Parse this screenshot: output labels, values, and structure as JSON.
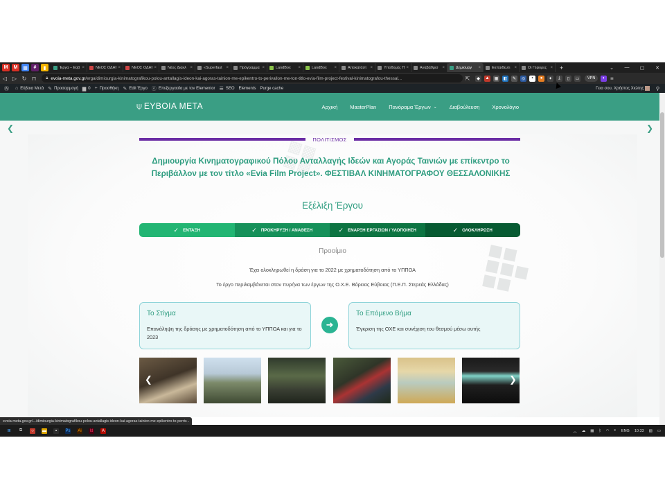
{
  "browser": {
    "pinned_tabs": [
      {
        "icon": "gmail-icon",
        "color": "#d93025",
        "glyph": "M"
      },
      {
        "icon": "gmail-icon",
        "color": "#d93025",
        "glyph": "M"
      },
      {
        "icon": "calendar-icon",
        "color": "#4285f4",
        "glyph": "▦"
      },
      {
        "icon": "slack-icon",
        "color": "#611f69",
        "glyph": "#"
      },
      {
        "icon": "keep-icon",
        "color": "#f4b400",
        "glyph": "▮"
      }
    ],
    "tabs": [
      {
        "title": "Έργα – Εύβ",
        "color": "#3a9e84",
        "active": false
      },
      {
        "title": "ΝΕΟΣ ΟΔΗΓ",
        "color": "#c44",
        "active": false
      },
      {
        "title": "ΝΕΟΣ ΟΔΗΓ",
        "color": "#c44",
        "active": false
      },
      {
        "title": "Νέος Διακλ",
        "color": "#888",
        "active": false
      },
      {
        "title": "«Superfast",
        "color": "#888",
        "active": false
      },
      {
        "title": "Πρόγραμμα",
        "color": "#888",
        "active": false
      },
      {
        "title": "LandBox",
        "color": "#8bc34a",
        "active": false
      },
      {
        "title": "LandBox",
        "color": "#8bc34a",
        "active": false
      },
      {
        "title": "Αποκατάστ",
        "color": "#888",
        "active": false
      },
      {
        "title": "Υποδομές Π",
        "color": "#888",
        "active": false
      },
      {
        "title": "Αναβάθμισ",
        "color": "#888",
        "active": false
      },
      {
        "title": "Δημιουργ",
        "color": "#3a9e84",
        "active": true
      },
      {
        "title": "Εκπαιδευτι",
        "color": "#888",
        "active": false
      },
      {
        "title": "Οι Γέφυρες",
        "color": "#888",
        "active": false
      }
    ],
    "new_tab": "+",
    "url_host": "evoia-meta.gov.gr",
    "url_path": "/erga/dimiourgia-kinimatografikou-polou-antallagis-ideon-kai-agoras-tainion-me-epikentro-to-perivallon-me-ton-titlo-evia-film-project-festival-kinimatografou-thessal...",
    "vpn": "VPN"
  },
  "wp_bar": {
    "site": "Εύβοια Μετά",
    "customize": "Προσαρμογή",
    "comments": "0",
    "new": "Προσθήκη",
    "edit": "Edit Έργο",
    "elementor": "Επεξεργασία με τον Elementor",
    "seo": "SEO",
    "elements": "Elements",
    "purge": "Purge cache",
    "greeting": "Γεια σου, Χρήστος Χιώτης"
  },
  "site_nav": {
    "logo": "ΕΥΒΟΙΑ ΜΕΤΑ",
    "menu": [
      {
        "label": "Αρχική",
        "caret": false
      },
      {
        "label": "MasterPlan",
        "caret": false
      },
      {
        "label": "Πανόραμα Έργων",
        "caret": true
      },
      {
        "label": "Διαβούλευση",
        "caret": false
      },
      {
        "label": "Χρονολόγιο",
        "caret": false
      }
    ]
  },
  "page": {
    "category": "ΠΟΛΙΤΙΣΜΟΣ",
    "title": "Δημιουργία Κινηματογραφικού Πόλου Ανταλλαγής Ιδεών και Αγοράς Ταινιών με επίκεντρο το Περιβάλλον με τον τίτλο «Evia Film Project». ΦΕΣΤΙΒΑΛ ΚΙΝΗΜΑΤΟΓΡΑΦΟΥ ΘΕΣΣΑΛΟΝΙΚΗΣ",
    "subtitle": "Εξέλιξη Έργου",
    "steps": [
      {
        "label": "ΕΝΤΑΞΗ",
        "color": "#22b573"
      },
      {
        "label": "ΠΡΟΚΗΡΥΞΗ / ΑΝΑΘΕΣΗ",
        "color": "#16915a"
      },
      {
        "label": "ΕΝΑΡΞΗ ΕΡΓΑΣΙΩΝ / ΥΛΟΠΟΙΗΣΗ",
        "color": "#0d7442"
      },
      {
        "label": "ΟΛΟΚΛΗΡΩΣΗ",
        "color": "#075a32"
      }
    ],
    "stage": "Προοίμιο",
    "info1": "Έχει ολοκληρωθεί η δράση για το 2022 με χρηματοδότηση από το ΥΠΠΟΑ",
    "info2": "Το έργο περιλαμβάνεται στον πυρήνα των έργων της Ο.Χ.Ε. Βόρειας Εύβοιας (Π.Ε.Π. Στερεάς Ελλάδας)",
    "card_left": {
      "heading": "Το Στίγμα",
      "body": "Επανάληψη της δράσης με χρηματοδότηση από το ΥΠΠΟΑ και για το 2023"
    },
    "card_right": {
      "heading": "Το Επόμενο Βήμα",
      "body": "Έγκριση της ΟΧΕ και συνέχιση του θεσμού μέσω αυτής"
    }
  },
  "status_link": "evoia-meta.gov.gr/.../dimiourgia-kinimatografikou-polou-antallagis-ideon-kai-agoras-tainion-me-epikentro-to-perriv...",
  "taskbar": {
    "lang": "ENG",
    "time": "10:33"
  }
}
